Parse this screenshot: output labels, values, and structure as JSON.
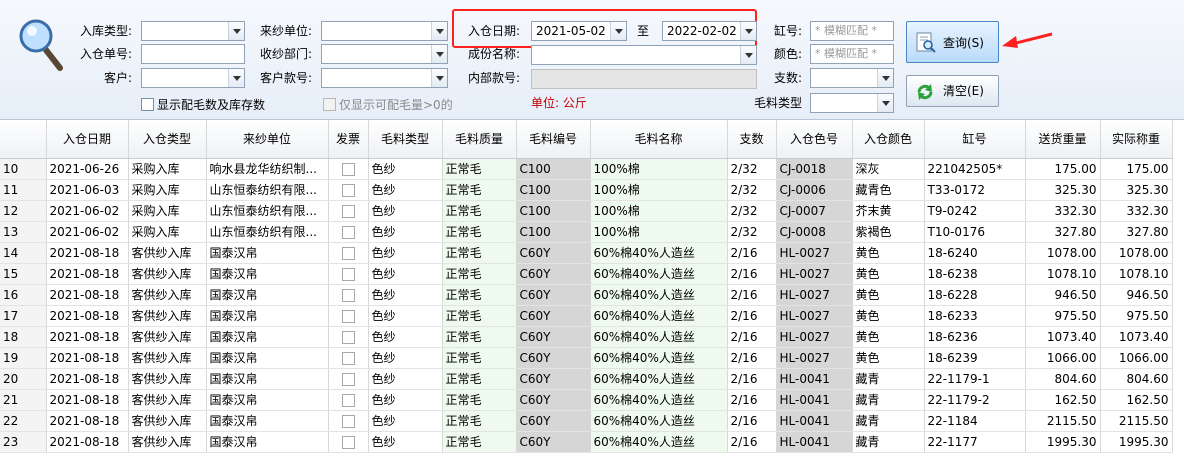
{
  "filters": {
    "inbound_type_label": "入库类型:",
    "inbound_type_value": "",
    "source_unit_label": "来纱单位:",
    "source_unit_value": "",
    "inbound_date_label": "入仓日期:",
    "date_from": "2021-05-02",
    "date_to_sep": "至",
    "date_to": "2022-02-02",
    "vat_no_label": "缸号:",
    "vat_no_placeholder": "* 模糊匹配 *",
    "inbound_no_label": "入仓单号:",
    "inbound_no_value": "",
    "receive_dept_label": "收纱部门:",
    "receive_dept_value": "",
    "composition_label": "成份名称:",
    "composition_value": "",
    "color_label": "颜色:",
    "color_placeholder": "* 模糊匹配 *",
    "customer_label": "客户:",
    "customer_value": "",
    "customer_style_label": "客户款号:",
    "customer_style_value": "",
    "internal_style_label": "内部款号:",
    "internal_style_value": "",
    "count_label": "支数:",
    "count_value": "",
    "show_matched_label": "显示配毛数及库存数",
    "show_available_label": "仅显示可配毛量>0的",
    "unit_text": "单位: 公斤",
    "wool_type_label": "毛料类型",
    "wool_type_value": ""
  },
  "buttons": {
    "query_label": "查询(S)",
    "clear_label": "清空(E)"
  },
  "colors": {
    "highlight_box": "#ff2020",
    "unit_text": "#c00000",
    "green_cell": "#eefaee",
    "gray_cell": "#d6d6d6"
  },
  "grid": {
    "columns": [
      "",
      "入仓日期",
      "入仓类型",
      "来纱单位",
      "发票",
      "毛料类型",
      "毛料质量",
      "毛料编号",
      "毛料名称",
      "支数",
      "入仓色号",
      "入仓颜色",
      "缸号",
      "送货重量",
      "实际称重"
    ],
    "rows": [
      [
        "10",
        "2021-06-26",
        "采购入库",
        "响水县龙华纺织制...",
        "",
        "色纱",
        "正常毛",
        "C100",
        "100%棉",
        "2/32",
        "CJ-0018",
        "深灰",
        "221042505*",
        "175.00",
        "175.00"
      ],
      [
        "11",
        "2021-06-03",
        "采购入库",
        "山东恒泰纺织有限...",
        "",
        "色纱",
        "正常毛",
        "C100",
        "100%棉",
        "2/32",
        "CJ-0006",
        "藏青色",
        "T33-0172",
        "325.30",
        "325.30"
      ],
      [
        "12",
        "2021-06-02",
        "采购入库",
        "山东恒泰纺织有限...",
        "",
        "色纱",
        "正常毛",
        "C100",
        "100%棉",
        "2/32",
        "CJ-0007",
        "芥末黄",
        "T9-0242",
        "332.30",
        "332.30"
      ],
      [
        "13",
        "2021-06-02",
        "采购入库",
        "山东恒泰纺织有限...",
        "",
        "色纱",
        "正常毛",
        "C100",
        "100%棉",
        "2/32",
        "CJ-0008",
        "紫褐色",
        "T10-0176",
        "327.80",
        "327.80"
      ],
      [
        "14",
        "2021-08-18",
        "客供纱入库",
        "国泰汉帛",
        "",
        "色纱",
        "正常毛",
        "C60Y",
        "60%棉40%人造丝",
        "2/16",
        "HL-0027",
        "黄色",
        "18-6240",
        "1078.00",
        "1078.00"
      ],
      [
        "15",
        "2021-08-18",
        "客供纱入库",
        "国泰汉帛",
        "",
        "色纱",
        "正常毛",
        "C60Y",
        "60%棉40%人造丝",
        "2/16",
        "HL-0027",
        "黄色",
        "18-6238",
        "1078.10",
        "1078.10"
      ],
      [
        "16",
        "2021-08-18",
        "客供纱入库",
        "国泰汉帛",
        "",
        "色纱",
        "正常毛",
        "C60Y",
        "60%棉40%人造丝",
        "2/16",
        "HL-0027",
        "黄色",
        "18-6228",
        "946.50",
        "946.50"
      ],
      [
        "17",
        "2021-08-18",
        "客供纱入库",
        "国泰汉帛",
        "",
        "色纱",
        "正常毛",
        "C60Y",
        "60%棉40%人造丝",
        "2/16",
        "HL-0027",
        "黄色",
        "18-6233",
        "975.50",
        "975.50"
      ],
      [
        "18",
        "2021-08-18",
        "客供纱入库",
        "国泰汉帛",
        "",
        "色纱",
        "正常毛",
        "C60Y",
        "60%棉40%人造丝",
        "2/16",
        "HL-0027",
        "黄色",
        "18-6236",
        "1073.40",
        "1073.40"
      ],
      [
        "19",
        "2021-08-18",
        "客供纱入库",
        "国泰汉帛",
        "",
        "色纱",
        "正常毛",
        "C60Y",
        "60%棉40%人造丝",
        "2/16",
        "HL-0027",
        "黄色",
        "18-6239",
        "1066.00",
        "1066.00"
      ],
      [
        "20",
        "2021-08-18",
        "客供纱入库",
        "国泰汉帛",
        "",
        "色纱",
        "正常毛",
        "C60Y",
        "60%棉40%人造丝",
        "2/16",
        "HL-0041",
        "藏青",
        "22-1179-1",
        "804.60",
        "804.60"
      ],
      [
        "21",
        "2021-08-18",
        "客供纱入库",
        "国泰汉帛",
        "",
        "色纱",
        "正常毛",
        "C60Y",
        "60%棉40%人造丝",
        "2/16",
        "HL-0041",
        "藏青",
        "22-1179-2",
        "162.50",
        "162.50"
      ],
      [
        "22",
        "2021-08-18",
        "客供纱入库",
        "国泰汉帛",
        "",
        "色纱",
        "正常毛",
        "C60Y",
        "60%棉40%人造丝",
        "2/16",
        "HL-0041",
        "藏青",
        "22-1184",
        "2115.50",
        "2115.50"
      ],
      [
        "23",
        "2021-08-18",
        "客供纱入库",
        "国泰汉帛",
        "",
        "色纱",
        "正常毛",
        "C60Y",
        "60%棉40%人造丝",
        "2/16",
        "HL-0041",
        "藏青",
        "22-1177",
        "1995.30",
        "1995.30"
      ]
    ]
  }
}
